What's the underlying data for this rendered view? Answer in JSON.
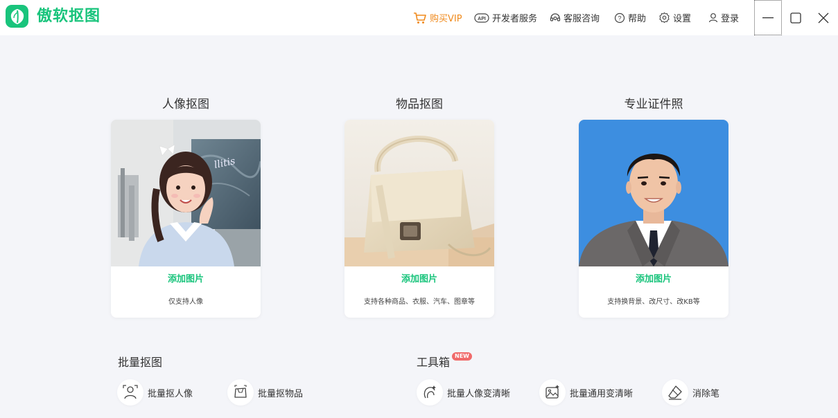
{
  "app": {
    "name": "傲软抠图"
  },
  "header": {
    "vip": "购买VIP",
    "developer": "开发者服务",
    "support": "客服咨询",
    "help": "帮助",
    "settings": "设置",
    "login": "登录"
  },
  "cards": [
    {
      "title": "人像抠图",
      "add": "添加图片",
      "desc": "仅支持人像"
    },
    {
      "title": "物品抠图",
      "add": "添加图片",
      "desc": "支持各种商品、衣服、汽车、图章等"
    },
    {
      "title": "专业证件照",
      "add": "添加图片",
      "desc": "支持换背景、改尺寸、改KB等"
    }
  ],
  "batch": {
    "title": "批量抠图",
    "items": [
      "批量抠人像",
      "批量抠物品"
    ]
  },
  "toolbox": {
    "title": "工具箱",
    "badge": "NEW",
    "items": [
      "批量人像变清晰",
      "批量通用变清晰",
      "消除笔"
    ]
  },
  "colors": {
    "brand": "#19c47c",
    "vip": "#f08a1c",
    "badge": "#f06a6a",
    "id_photo_bg": "#3d8ee0"
  }
}
